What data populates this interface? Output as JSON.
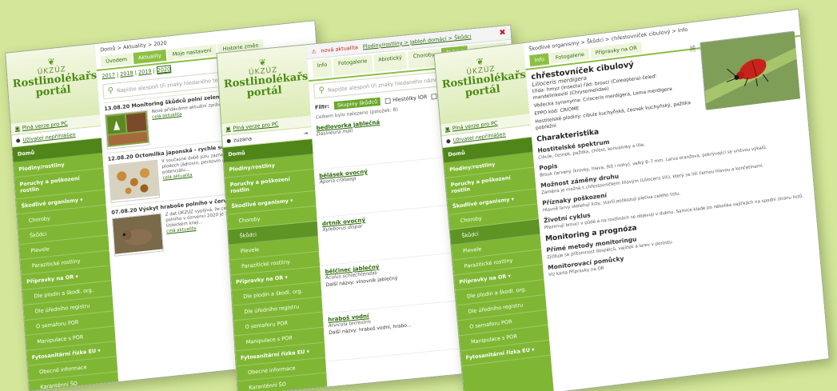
{
  "window1": {
    "breadcrumb": "Domů > Aktuality > 2020",
    "tabs": [
      {
        "label": "Úvodem"
      },
      {
        "label": "Aktuality"
      },
      {
        "label": "Moje nastavení"
      },
      {
        "label": "Historie změn"
      }
    ],
    "years": [
      "2017",
      "2018",
      "2019",
      "2020"
    ],
    "search_placeholder": "Napište alespoň tři znaky hledaného textu...",
    "sidebar": {
      "ukzuz": "ÚKZÚZ",
      "portal_line1": "Rostlinolékařský",
      "portal_line2": "portál",
      "pc_link": "Plná verze pro PC",
      "user": "Uživatel nepřihlášen",
      "items": [
        "Domů",
        "Plodiny/rostliny",
        "Poruchy a poškození rostlin",
        "Škodlivé organismy ▾",
        "Choroby",
        "Škůdci",
        "Plevele",
        "Parazitické rostliny",
        "Přípravky na OR ▾",
        "Dle plodin a škodl. org.",
        "Dle úředního registru",
        "O semaforu POR",
        "Manipulace s POR",
        "Fytosanitární řízka EU ▾",
        "Obecné informace",
        "Karanténní ŠO"
      ]
    },
    "news": [
      {
        "title": "13.08.20 Monitoring škůdců polní zeleniny",
        "text": "Nově přidáváme aktuální zprávy z ostatních oblastí ČR zaměřené na...",
        "link": "celá aktualita"
      },
      {
        "title": "12.08.20 Octomilka japonská - rychle se šířící ŠO jádrovin, pecko...",
        "text": "V současné době jsou zaznamenány výskyty octomilky japonské na plodech jádrovin, peckovin a ve vinicích. Vhledem k invaznímu potenciálu...",
        "link": "celá aktualita"
      },
      {
        "title": "07.08.20 Výskyt hraboše polního v červenci 2020",
        "text": "Z dat ÚKZÚZ vyplývá, že celorepublikový průměr výskytu hraboše polního v červenci 2020 je 300 aktivních východů. Vysoký počet byl v Ústeckém kraji...",
        "link": "celá aktualita"
      }
    ]
  },
  "window2": {
    "topbar": {
      "alert": "nová aktualita",
      "links": "Plodiny/rostliny > Jabloň domácí > Škůdci"
    },
    "tabs": [
      {
        "label": "Info"
      },
      {
        "label": "Fotogalerie"
      },
      {
        "label": "Abiotický"
      },
      {
        "label": "Choroby"
      },
      {
        "label": "Škůdci"
      },
      {
        "label": "Ostatní kapitoly ▾"
      }
    ],
    "search_placeholder": "Napište alespoň tři znaky hledaného názvu...",
    "filter_label": "Filtr:",
    "filter_chip": "Skupiny škůdců",
    "filter_opts": [
      "Hlestólky IOR",
      "Monitoring",
      "Regulace"
    ],
    "count_text": "Celkem bylo nalezeno (položek: 8)",
    "user": "zuzana",
    "items": [
      {
        "name": "bedlovorka jablečná",
        "lat": "Dasineura mali",
        "extra": ""
      },
      {
        "name": "bělásek ovocný",
        "lat": "Aporia crataegi",
        "extra": ""
      },
      {
        "name": "drtník ovocný",
        "lat": "Xyleborus dispar",
        "extra": ""
      },
      {
        "name": "bělčinec jablečný",
        "lat": "Aculus schlechtendali",
        "extra": "Další názvy: vlnovník jablečný"
      },
      {
        "name": "hraboš vodní",
        "lat": "Arvicola terrestris",
        "extra": "Další názvy: hraboš vodní, hrabo..."
      }
    ]
  },
  "window3": {
    "breadcrumb": "Škodlivé organismy > Škůdci > chřestovníček cibulový > Info",
    "tabs": [
      {
        "label": "Info"
      },
      {
        "label": "Fotogalerie"
      },
      {
        "label": "Přípravky na OR"
      }
    ],
    "title": "chřestovníček cibulový",
    "latin": "Lilioceris merdigera",
    "rows": [
      "třída: hmyz (Insecta) řád: brouci (Coleoptera) čeleď: mandelinkovití (Chrysomelidae)",
      "Vědecká synonyma: Crioceris merdigera, Lema merdigera",
      "EPPO kód: CRIOME",
      "Hostitelské plodiny: cibule kuchyňská, česnek kuchyňský, pažitka pobřežní"
    ],
    "sections": [
      {
        "h": "Charakteristika",
        "level": 2,
        "p": ""
      },
      {
        "h": "Hostitelské spektrum",
        "level": 3,
        "p": "Cibule, česnek, pažitka, chřest, konvalinky a lilie."
      },
      {
        "h": "Popis",
        "level": 3,
        "p": "Brouk červený (krovky, hlava, štít i nohy), velký 6–7 mm. Larva oranžová, pokrývající se vrstvou výkalů."
      },
      {
        "h": "Možnost záměny druhu",
        "level": 3,
        "p": "Záměna je možná s chřestovníčkem liliovým (Lilioceris lilii), který se liší černou hlavou a končetinami."
      },
      {
        "h": "Příznaky poškození",
        "level": 3,
        "p": "Hlavně larvy skeletují listy, starší poškozují pletiva celého listu."
      },
      {
        "h": "Životní cyklus",
        "level": 3,
        "p": "Přezimují brouci v půdě a na rostlinách se objevují v dubnu. Samice klade po několika vajíčkách na spodní stranu listů."
      },
      {
        "h": "Monitoring a prognóza",
        "level": 2,
        "p": ""
      },
      {
        "h": "Přímé metody monitoringu",
        "level": 3,
        "p": "Zjišťuje se přítomnost dospělců, vajíček a larev v porostu."
      },
      {
        "h": "Monitorovací pomůcky",
        "level": 3,
        "p": "Viz karta Přípravky na OR"
      }
    ],
    "sidebar_items": [
      "Domů",
      "Plodiny/rostliny",
      "Poruchy a poškození rostlin",
      "Škodlivé organismy ▾",
      "Choroby",
      "Škůdci",
      "Plevele",
      "Parazitické rostliny",
      "Přípravky na OR ▾",
      "Dle plodin a škodl. org.",
      "Dle úředního registru",
      "O semaforu POR",
      "Manipulace s POR",
      "Fytosanitární řízka EU ▾"
    ]
  }
}
